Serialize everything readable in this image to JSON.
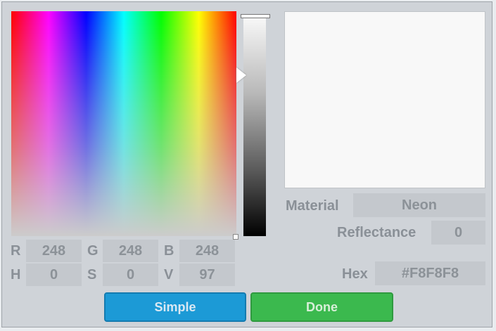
{
  "rgb": {
    "r_label": "R",
    "r_value": "248",
    "g_label": "G",
    "g_value": "248",
    "b_label": "B",
    "b_value": "248"
  },
  "hsv": {
    "h_label": "H",
    "h_value": "0",
    "s_label": "S",
    "s_value": "0",
    "v_label": "V",
    "v_value": "97"
  },
  "material": {
    "label": "Material",
    "value": "Neon"
  },
  "reflectance": {
    "label": "Reflectance",
    "value": "0"
  },
  "hex": {
    "label": "Hex",
    "value": "#F8F8F8"
  },
  "buttons": {
    "simple": "Simple",
    "done": "Done"
  },
  "colors": {
    "preview": "#F8F8F8",
    "simple_button": "#1C9AD6",
    "done_button": "#3BB94E"
  },
  "icons": {
    "value_pointer": "triangle-pointer-icon"
  }
}
